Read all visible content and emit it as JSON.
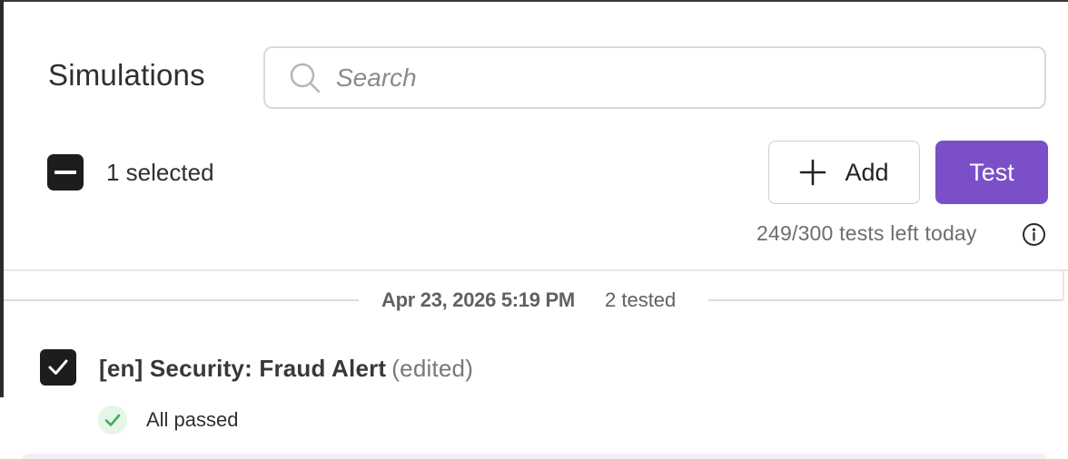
{
  "header": {
    "title": "Simulations"
  },
  "search": {
    "placeholder": "Search",
    "value": ""
  },
  "toolbar": {
    "selected_count": "1 selected",
    "add_label": "Add",
    "test_label": "Test",
    "quota_text": "249/300 tests left today"
  },
  "group": {
    "date": "Apr 23, 2026 5:19 PM",
    "tested": "2 tested"
  },
  "items": [
    {
      "title": "[en] Security: Fraud Alert",
      "edited": "(edited)",
      "status": "All passed",
      "checked": true
    }
  ],
  "colors": {
    "accent": "#7a4fc7",
    "checkbox": "#1d1d20",
    "success": "#3fae5a",
    "success_bg": "#e3f6e7"
  },
  "icons": {
    "search": "search-icon",
    "add": "plus-icon",
    "info": "info-icon",
    "check": "checkmark-icon",
    "indeterminate": "minus-icon",
    "status": "check-circle-icon"
  }
}
